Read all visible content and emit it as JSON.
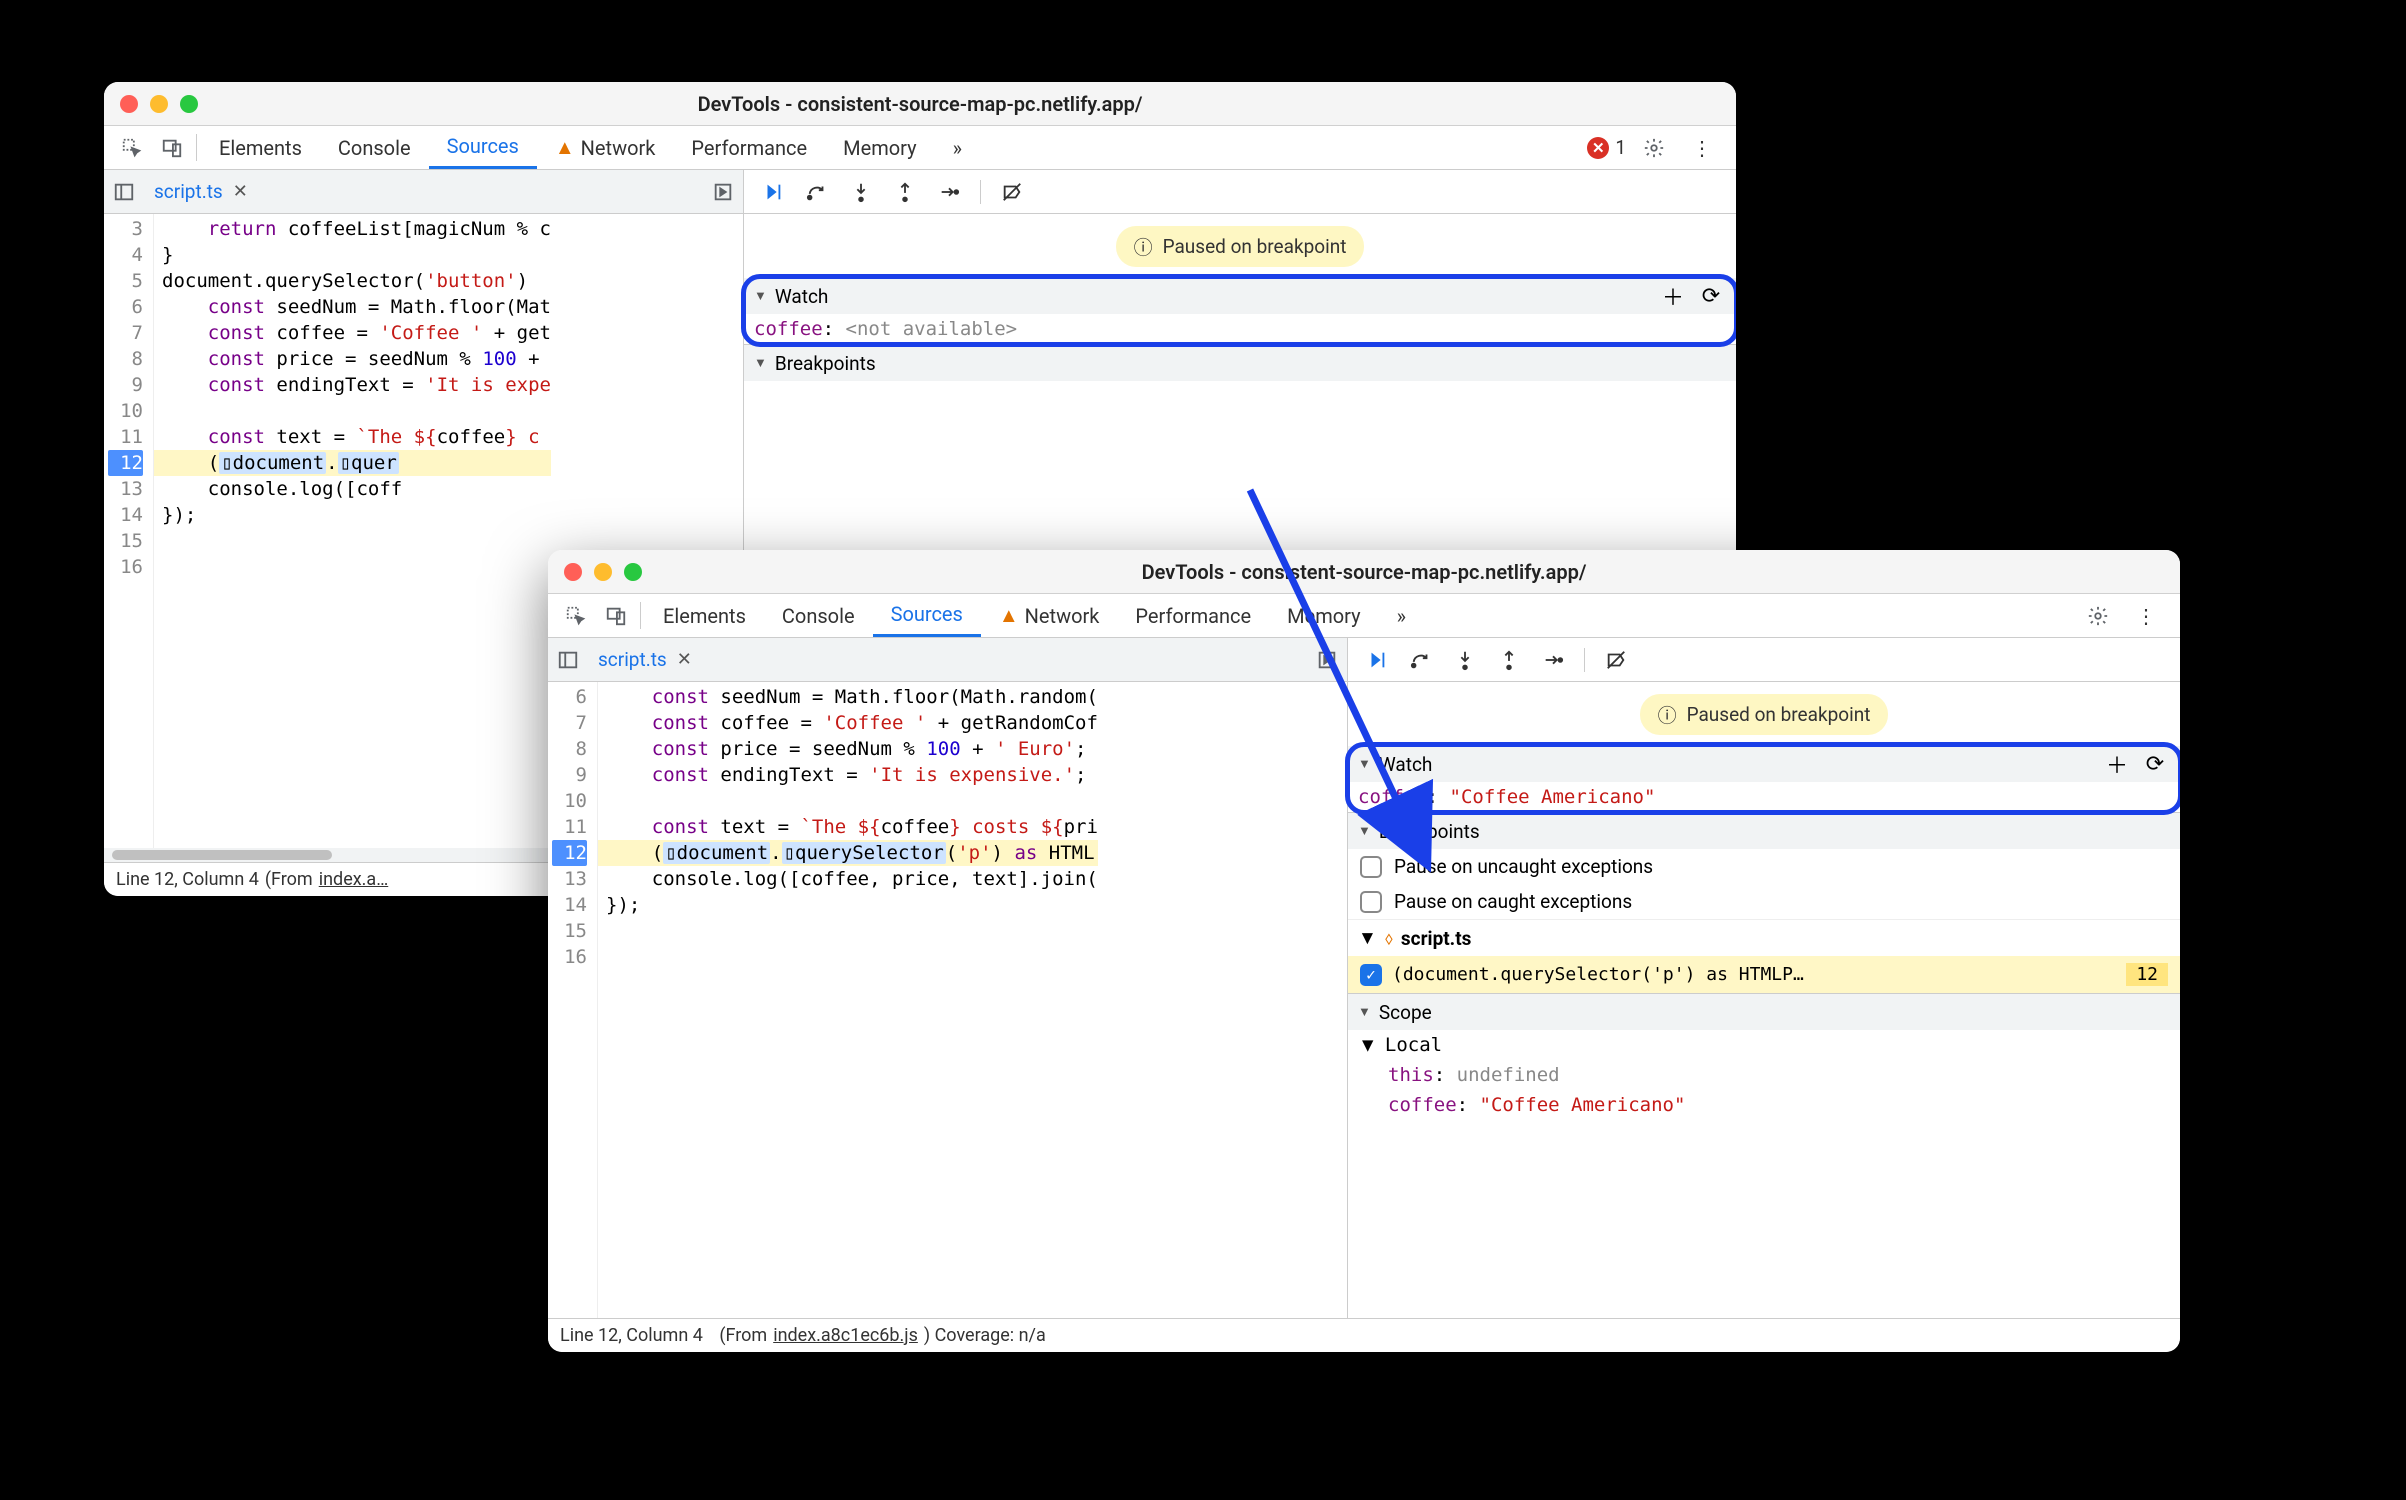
{
  "window1": {
    "title": "DevTools - consistent-source-map-pc.netlify.app/",
    "tabs": [
      "Elements",
      "Console",
      "Sources",
      "Network",
      "Performance",
      "Memory"
    ],
    "active_tab": "Sources",
    "error_count": "1",
    "file_tab": "script.ts",
    "gutter_start": 3,
    "code_lines": [
      {
        "n": 3,
        "html": "    <span class='tok-kw'>return</span> coffeeList[magicNum % c"
      },
      {
        "n": 4,
        "html": "}"
      },
      {
        "n": 5,
        "html": "document.querySelector(<span class='tok-str'>'button'</span>)"
      },
      {
        "n": 6,
        "html": "    <span class='tok-kw'>const</span> seedNum = Math.floor(Mat"
      },
      {
        "n": 7,
        "html": "    <span class='tok-kw'>const</span> coffee = <span class='tok-str'>'Coffee '</span> + get"
      },
      {
        "n": 8,
        "html": "    <span class='tok-kw'>const</span> price = seedNum % <span class='tok-num'>100</span> + "
      },
      {
        "n": 9,
        "html": "    <span class='tok-kw'>const</span> endingText = <span class='tok-str'>'It is expe"
      },
      {
        "n": 10,
        "html": ""
      },
      {
        "n": 11,
        "html": "    <span class='tok-kw'>const</span> text = <span class='tok-str'>`The ${</span>coffee<span class='tok-str'>} c</span>"
      },
      {
        "n": 12,
        "hl": true,
        "html": "    (<span class='tok-bg1'>▯document</span>.<span class='tok-bg1'>▯quer</span>"
      },
      {
        "n": 13,
        "html": "    console.log([coff"
      },
      {
        "n": 14,
        "html": "});"
      },
      {
        "n": 15,
        "html": ""
      },
      {
        "n": 16,
        "html": ""
      }
    ],
    "paused_label": "Paused on breakpoint",
    "watch_label": "Watch",
    "watch_name": "coffee",
    "watch_value": "<not available>",
    "breakpoints_label": "Breakpoints",
    "status_line": "Line 12, Column 4",
    "status_from": "(From ",
    "status_from_file": "index.a…"
  },
  "window2": {
    "title": "DevTools - consistent-source-map-pc.netlify.app/",
    "tabs": [
      "Elements",
      "Console",
      "Sources",
      "Network",
      "Performance",
      "Memory"
    ],
    "active_tab": "Sources",
    "file_tab": "script.ts",
    "code_lines": [
      {
        "n": 6,
        "html": "    <span class='tok-kw'>const</span> seedNum = Math.floor(Math.random("
      },
      {
        "n": 7,
        "html": "    <span class='tok-kw'>const</span> coffee = <span class='tok-str'>'Coffee '</span> + getRandomCof"
      },
      {
        "n": 8,
        "html": "    <span class='tok-kw'>const</span> price = seedNum % <span class='tok-num'>100</span> + <span class='tok-str'>' Euro'</span>;"
      },
      {
        "n": 9,
        "html": "    <span class='tok-kw'>const</span> endingText = <span class='tok-str'>'It is expensive.'</span>;"
      },
      {
        "n": 10,
        "html": ""
      },
      {
        "n": 11,
        "html": "    <span class='tok-kw'>const</span> text = <span class='tok-str'>`The ${</span>coffee<span class='tok-str'>} costs ${</span>pri"
      },
      {
        "n": 12,
        "hl": true,
        "html": "    (<span class='tok-bg1'>▯document</span>.<span class='tok-bg1'>▯querySelector</span>(<span class='tok-str'>'p'</span>) <span class='tok-kw'>as</span> HTML"
      },
      {
        "n": 13,
        "html": "    console.log([coffee, price, text].join("
      },
      {
        "n": 14,
        "html": "});"
      },
      {
        "n": 15,
        "html": ""
      },
      {
        "n": 16,
        "html": ""
      }
    ],
    "paused_label": "Paused on breakpoint",
    "watch_label": "Watch",
    "watch_name": "coffee",
    "watch_value": "\"Coffee Americano\"",
    "breakpoints_label": "Breakpoints",
    "bp_uncaught": "Pause on uncaught exceptions",
    "bp_caught": "Pause on caught exceptions",
    "bp_file": "script.ts",
    "bp_entry": "(document.querySelector('p') as HTMLP…",
    "bp_line": "12",
    "scope_label": "Scope",
    "scope_local": "Local",
    "scope_this": "this",
    "scope_this_val": "undefined",
    "scope_coffee": "coffee",
    "scope_coffee_val": "\"Coffee Americano\"",
    "status_line": "Line 12, Column 4",
    "status_from": "(From ",
    "status_from_file": "index.a8c1ec6b.js",
    "status_cov": ") Coverage: n/a"
  }
}
